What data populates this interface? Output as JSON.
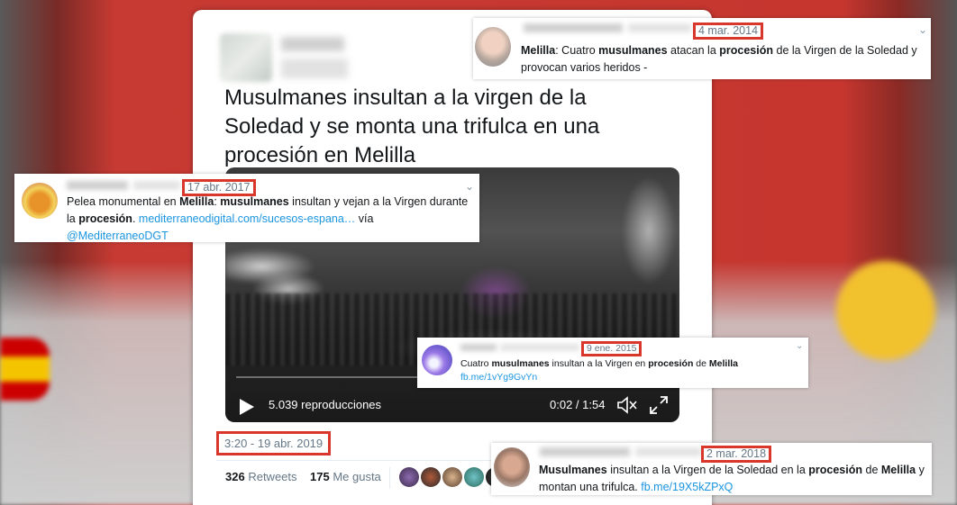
{
  "main_tweet": {
    "headline": "Musulmanes insultan a la virgen de la Soledad y se monta una trifulca en una procesión en Melilla",
    "video": {
      "views": "5.039 reproducciones",
      "time": "0:02 / 1:54"
    },
    "timestamp": "3:20 - 19 abr. 2019",
    "retweets_count": "326",
    "retweets_label": "Retweets",
    "likes_count": "175",
    "likes_label": "Me gusta"
  },
  "snippet_2014": {
    "date": "4 mar. 2014",
    "t1": "Melilla",
    "t2": ": Cuatro ",
    "t3": "musulmanes",
    "t4": " atacan la ",
    "t5": "procesión",
    "t6": " de la Virgen de la Soledad y provocan varios heridos -"
  },
  "snippet_2017": {
    "date": "17 abr. 2017",
    "t1": "Pelea monumental en ",
    "t2": "Melilla",
    "t3": ": ",
    "t4": "musulmanes",
    "t5": " insultan y vejan a la Virgen durante la ",
    "t6": "procesión",
    "t7": ". ",
    "link": "mediterraneodigital.com/sucesos-espana…",
    "t8": " vía ",
    "handle": "@MediterraneoDGT"
  },
  "snippet_2015": {
    "date": "9 ene. 2015",
    "t1": "Cuatro ",
    "t2": "musulmanes",
    "t3": " insultan a la Virgen en ",
    "t4": "procesión",
    "t5": " de ",
    "t6": "Melilla",
    "link": "fb.me/1vYg9GvYn"
  },
  "snippet_2018": {
    "date": "2 mar. 2018",
    "t1": "Musulmanes",
    "t2": " insultan a la Virgen de la Soledad en la ",
    "t3": "procesión",
    "t4": " de ",
    "t5": "Melilla",
    "t6": " y montan una trifulca. ",
    "link": "fb.me/19X5kZPxQ"
  },
  "colors": {
    "highlight_border": "#d9372b",
    "link": "#1b95e0",
    "background_red": "#c6362f"
  }
}
